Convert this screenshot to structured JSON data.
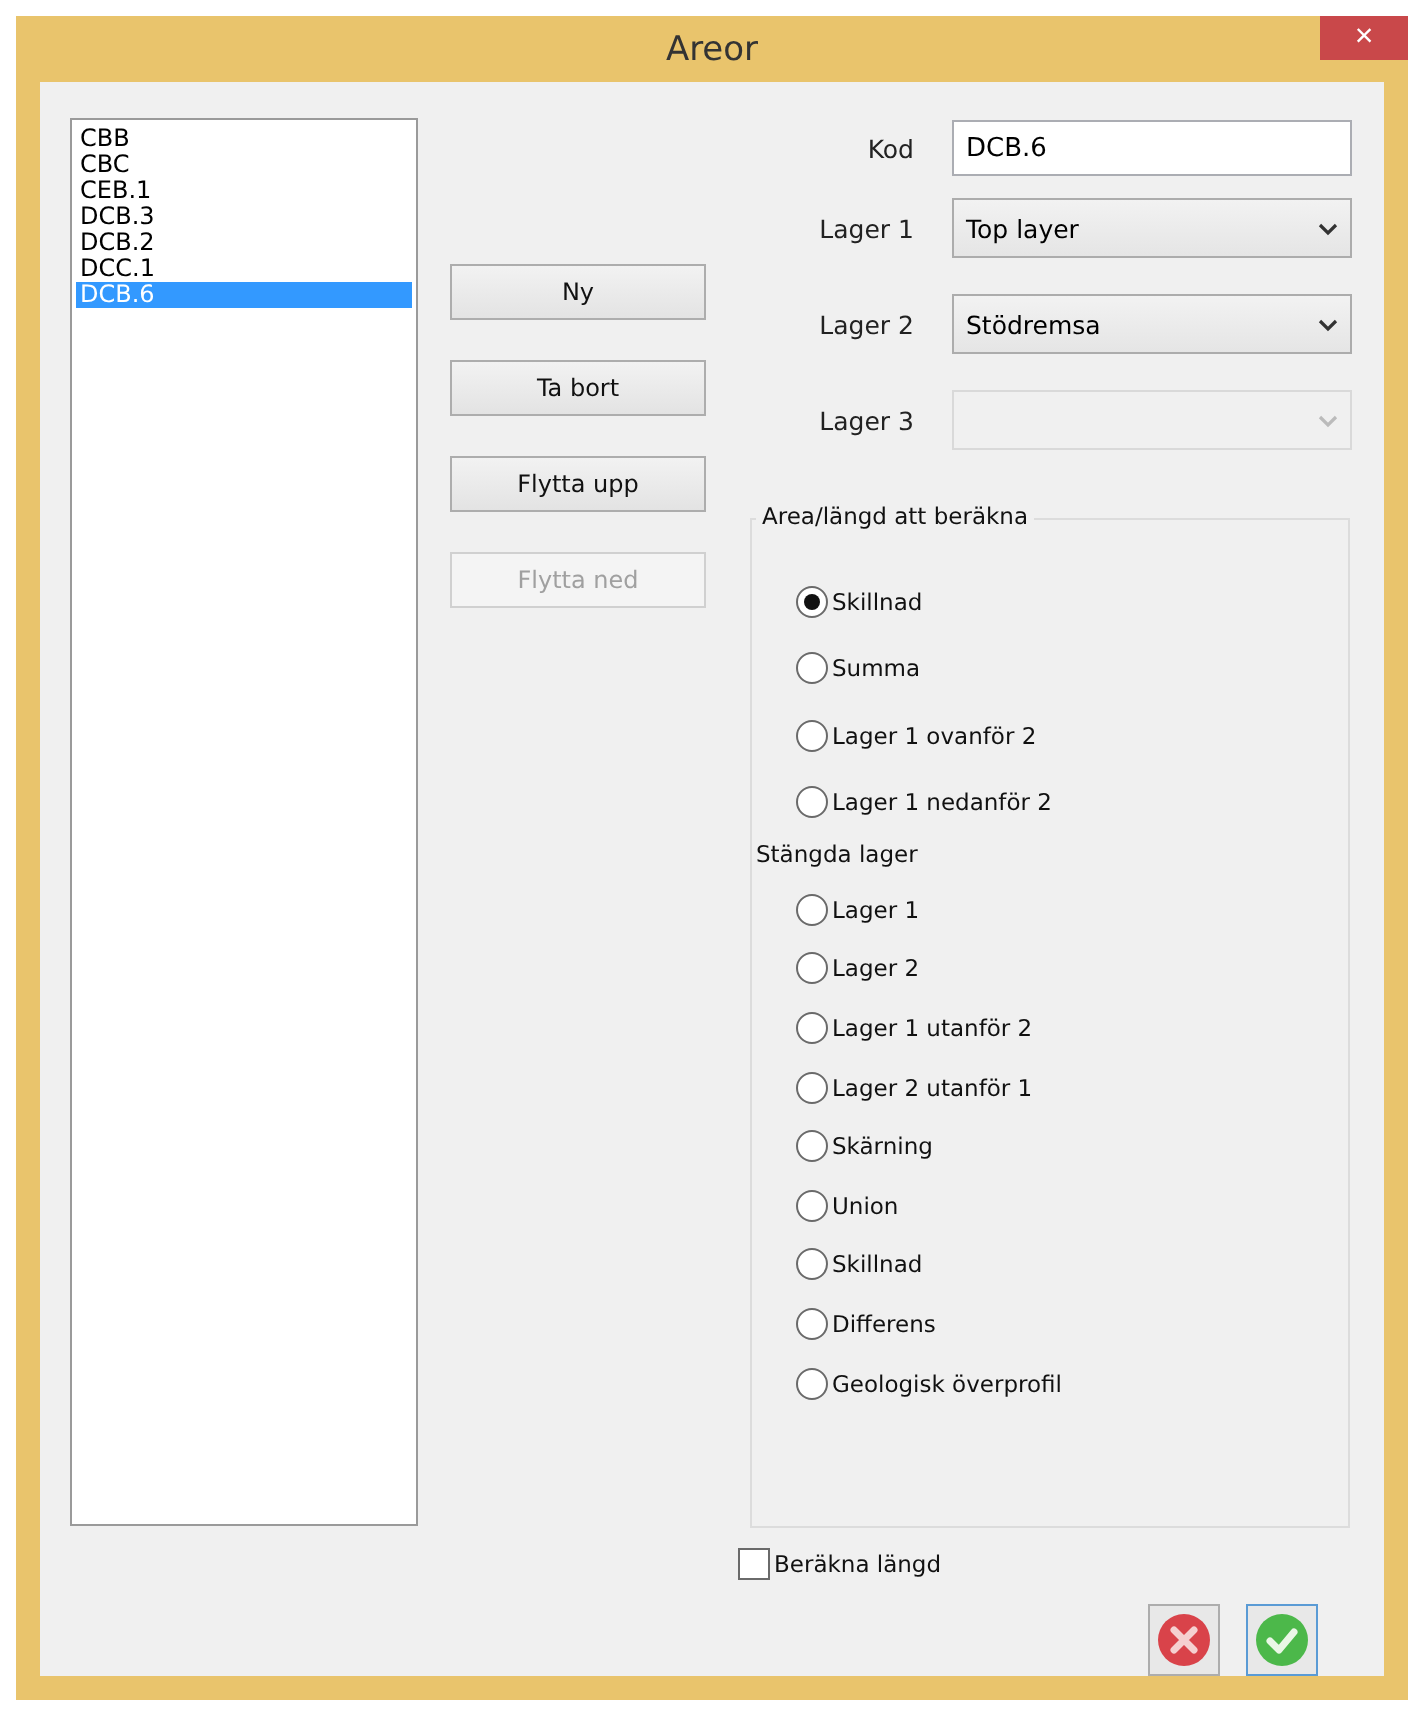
{
  "window": {
    "title": "Areor",
    "close": "×"
  },
  "codes": [
    {
      "label": "CBB",
      "selected": false
    },
    {
      "label": "CBC",
      "selected": false
    },
    {
      "label": "CEB.1",
      "selected": false
    },
    {
      "label": "DCB.3",
      "selected": false
    },
    {
      "label": "DCB.2",
      "selected": false
    },
    {
      "label": "DCC.1",
      "selected": false
    },
    {
      "label": "DCB.6",
      "selected": true
    }
  ],
  "buttons": [
    {
      "label": "Ny",
      "disabled": false
    },
    {
      "label": "Ta bort",
      "disabled": false
    },
    {
      "label": "Flytta upp",
      "disabled": false
    },
    {
      "label": "Flytta ned",
      "disabled": true
    }
  ],
  "fields": [
    {
      "kind": "text",
      "label": "Kod",
      "value": "DCB.6"
    },
    {
      "kind": "select",
      "label": "Lager 1",
      "value": "Top layer",
      "disabled": false
    },
    {
      "kind": "select",
      "label": "Lager 2",
      "value": "Stödremsa",
      "disabled": false
    },
    {
      "kind": "select",
      "label": "Lager 3",
      "disabled": true
    }
  ],
  "group": {
    "title": "Area/längd att beräkna",
    "options": [
      {
        "label": "Skillnad",
        "selected": true
      },
      {
        "label": "Summa",
        "selected": false
      },
      {
        "label": "Lager 1 ovanför 2",
        "selected": false
      },
      {
        "label": "Lager 1 nedanför 2",
        "selected": false
      }
    ],
    "closed_title": "Stängda lager",
    "closed_options": [
      {
        "label": "Lager 1",
        "selected": false
      },
      {
        "label": "Lager 2",
        "selected": false
      },
      {
        "label": "Lager 1 utanför 2",
        "selected": false
      },
      {
        "label": "Lager 2 utanför 1",
        "selected": false
      },
      {
        "label": "Skärning",
        "selected": false
      },
      {
        "label": "Union",
        "selected": false
      },
      {
        "label": "Skillnad",
        "selected": false
      },
      {
        "label": "Differens",
        "selected": false
      },
      {
        "label": "Geologisk överprofil",
        "selected": false
      }
    ]
  },
  "compute_length": {
    "label": "Beräkna längd",
    "checked": false
  }
}
